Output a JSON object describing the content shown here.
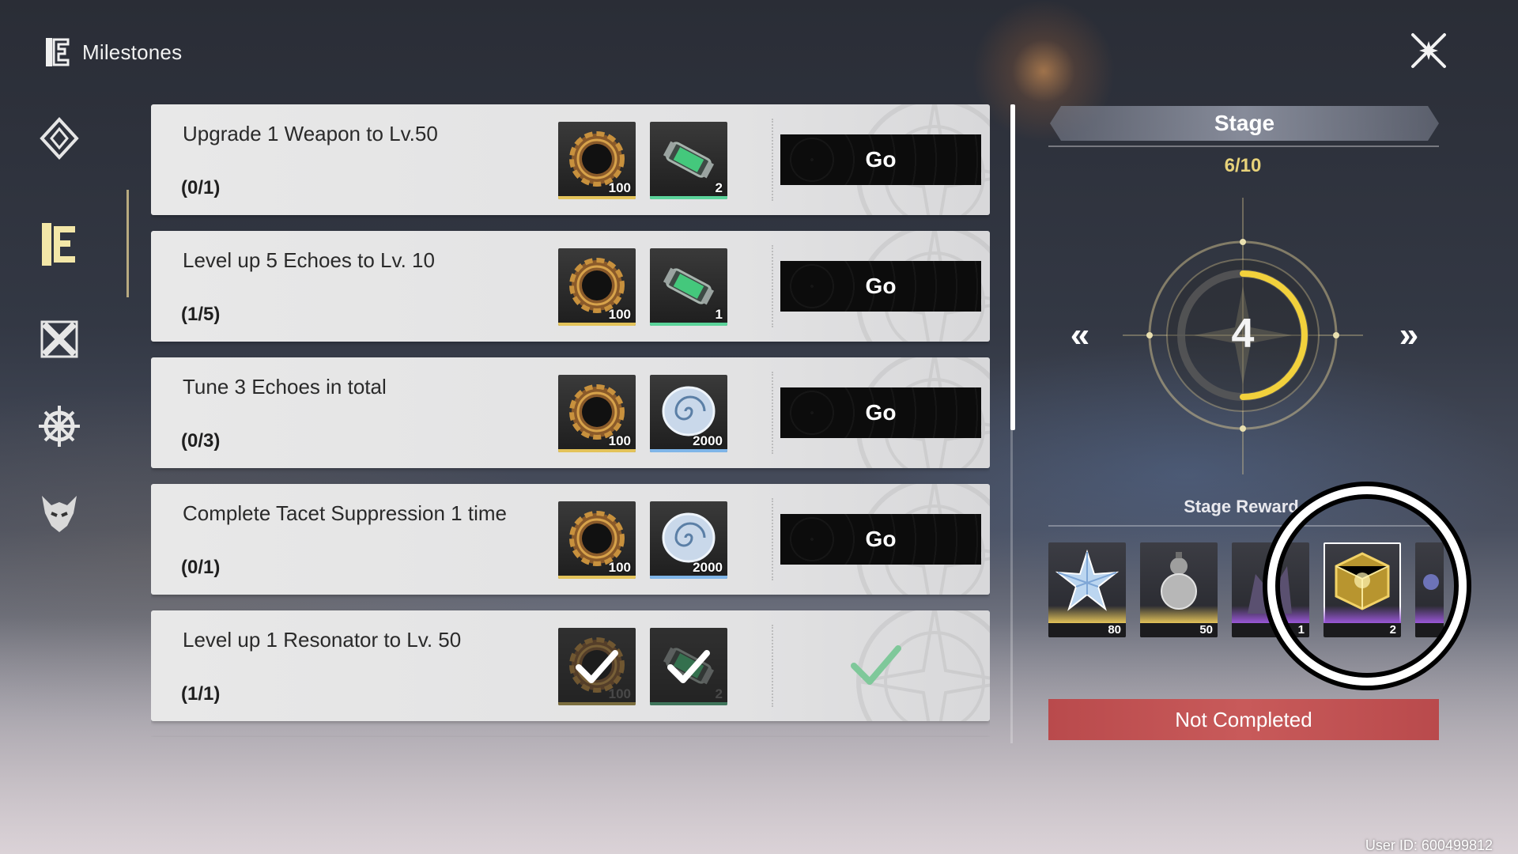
{
  "header": {
    "title": "Milestones",
    "icon": "milestones-icon"
  },
  "close_icon": "close-icon",
  "sidebar": {
    "items": [
      {
        "icon": "diamond-compass-icon",
        "active": false
      },
      {
        "icon": "milestones-icon",
        "active": true
      },
      {
        "icon": "crossed-x-icon",
        "active": false
      },
      {
        "icon": "snowflake-gear-icon",
        "active": false
      },
      {
        "icon": "demon-mask-icon",
        "active": false
      }
    ]
  },
  "tasks": [
    {
      "title": "Upgrade 1 Weapon to Lv.50",
      "progress": "(0/1)",
      "button_label": "Go",
      "completed": false,
      "rewards": [
        {
          "icon": "gear-coin-icon",
          "qty": "100",
          "accent": "#e3c35a"
        },
        {
          "icon": "energy-tube-icon",
          "qty": "2",
          "accent": "#5bd39a"
        }
      ]
    },
    {
      "title": "Level up 5 Echoes to Lv. 10",
      "progress": "(1/5)",
      "button_label": "Go",
      "completed": false,
      "rewards": [
        {
          "icon": "gear-coin-icon",
          "qty": "100",
          "accent": "#e3c35a"
        },
        {
          "icon": "energy-tube-icon",
          "qty": "1",
          "accent": "#5bd39a"
        }
      ]
    },
    {
      "title": "Tune 3 Echoes in total",
      "progress": "(0/3)",
      "button_label": "Go",
      "completed": false,
      "rewards": [
        {
          "icon": "gear-coin-icon",
          "qty": "100",
          "accent": "#e3c35a"
        },
        {
          "icon": "shell-credit-icon",
          "qty": "2000",
          "accent": "#7fb5e8"
        }
      ]
    },
    {
      "title": "Complete Tacet Suppression 1 time",
      "progress": "(0/1)",
      "button_label": "Go",
      "completed": false,
      "rewards": [
        {
          "icon": "gear-coin-icon",
          "qty": "100",
          "accent": "#e3c35a"
        },
        {
          "icon": "shell-credit-icon",
          "qty": "2000",
          "accent": "#7fb5e8"
        }
      ]
    },
    {
      "title": "Level up 1 Resonator to Lv. 50",
      "progress": "(1/1)",
      "button_label": "",
      "completed": true,
      "rewards": [
        {
          "icon": "gear-coin-icon",
          "qty": "100",
          "accent": "#e3c35a"
        },
        {
          "icon": "energy-tube-icon",
          "qty": "2",
          "accent": "#5bd39a"
        }
      ]
    }
  ],
  "stage": {
    "title": "Stage",
    "count": "6/10",
    "current": "4",
    "progress_fraction": 0.5,
    "prev_label": "«",
    "next_label": "»",
    "reward_label": "Stage Reward",
    "rewards": [
      {
        "icon": "star-crystal-icon",
        "qty": "80",
        "accent": "#e3c35a"
      },
      {
        "icon": "gourd-flask-icon",
        "qty": "50",
        "accent": "#e3c35a"
      },
      {
        "icon": "dragon-echo-icon",
        "qty": "1",
        "accent": "#9a58d8"
      },
      {
        "icon": "golden-cube-icon",
        "qty": "2",
        "accent": "#9a58d8",
        "selected": true
      },
      {
        "icon": "partial-item-icon",
        "qty": "",
        "accent": "#9a58d8"
      }
    ],
    "status": "Not Completed",
    "status_color": "#c85a5a"
  },
  "user_id": "User ID: 600499812"
}
